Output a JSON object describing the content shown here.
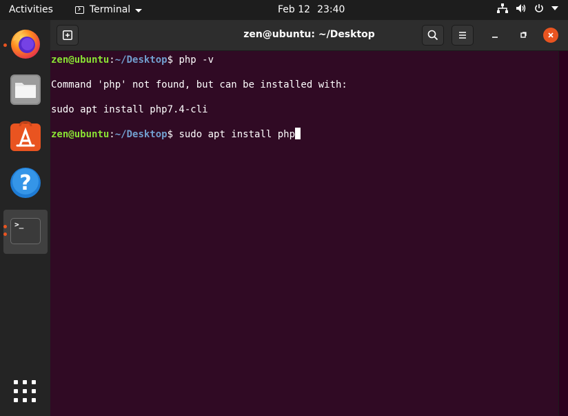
{
  "topbar": {
    "activities": "Activities",
    "app_menu": "Terminal",
    "date": "Feb 12",
    "time": "23:40",
    "tray_icons": [
      "network-icon",
      "volume-icon",
      "power-icon",
      "chevron-down-icon"
    ]
  },
  "dock": {
    "items": [
      {
        "name": "Firefox",
        "icon": "firefox-icon",
        "running": true
      },
      {
        "name": "Files",
        "icon": "files-icon",
        "running": false
      },
      {
        "name": "Ubuntu Software",
        "icon": "software-icon",
        "running": false
      },
      {
        "name": "Help",
        "icon": "help-icon",
        "running": false
      },
      {
        "name": "Terminal",
        "icon": "terminal-icon",
        "running": true,
        "active": true
      }
    ],
    "show_apps_icon": "app-grid-icon",
    "terminal_glyph": ">_",
    "help_glyph": "?"
  },
  "window": {
    "title": "zen@ubuntu: ~/Desktop",
    "new_tab_icon": "new-tab-icon",
    "search_icon": "search-icon",
    "menu_icon": "hamburger-icon"
  },
  "terminal": {
    "prompt_user": "zen@ubuntu",
    "prompt_colon": ":",
    "prompt_path": "~/Desktop",
    "prompt_symbol": "$ ",
    "lines": [
      {
        "command": "php -v"
      },
      {
        "output": "Command 'php' not found, but can be installed with:"
      },
      {
        "output": "sudo apt install php7.4-cli"
      },
      {
        "command": "sudo apt install php"
      }
    ]
  },
  "colors": {
    "terminal_bg": "#300a24",
    "prompt_user": "#8ae234",
    "prompt_path": "#729fcf",
    "accent": "#e95420"
  }
}
